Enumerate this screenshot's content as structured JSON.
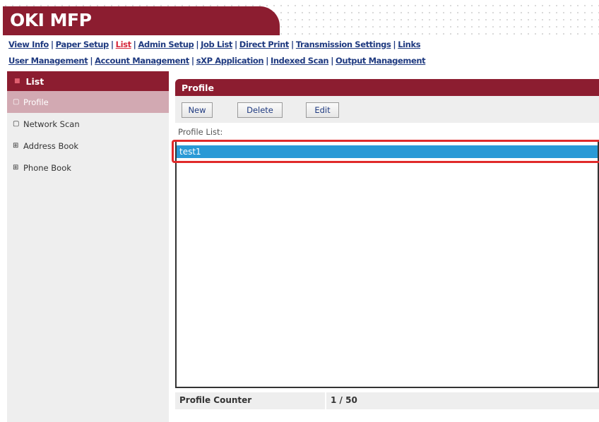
{
  "header": {
    "brand": "OKI MFP",
    "brand_color": "#8c1d30"
  },
  "nav": {
    "row1": [
      {
        "label": "View Info",
        "active": false
      },
      {
        "label": "Paper Setup",
        "active": false
      },
      {
        "label": "List",
        "active": true
      },
      {
        "label": "Admin Setup",
        "active": false
      },
      {
        "label": "Job List",
        "active": false
      },
      {
        "label": "Direct Print",
        "active": false
      },
      {
        "label": "Transmission Settings",
        "active": false
      },
      {
        "label": "Links",
        "active": false
      }
    ],
    "row2": [
      {
        "label": "User Management"
      },
      {
        "label": "Account Management"
      },
      {
        "label": "sXP Application"
      },
      {
        "label": "Indexed Scan"
      },
      {
        "label": "Output Management"
      }
    ]
  },
  "sidebar": {
    "title": "List",
    "items": [
      {
        "label": "Profile",
        "icon": "radio-empty-icon",
        "selected": true
      },
      {
        "label": "Network Scan",
        "icon": "radio-empty-icon",
        "selected": false
      },
      {
        "label": "Address Book",
        "icon": "expand-plus-icon",
        "selected": false
      },
      {
        "label": "Phone Book",
        "icon": "expand-plus-icon",
        "selected": false
      }
    ]
  },
  "main": {
    "title": "Profile",
    "buttons": {
      "new": "New",
      "delete": "Delete",
      "edit": "Edit"
    },
    "list_label": "Profile List:",
    "list_items": [
      "test1"
    ],
    "selected_item_color": "#2a9ad6",
    "highlight_color": "#e02a2a",
    "counter_label": "Profile Counter",
    "counter_value": "1 / 50"
  }
}
